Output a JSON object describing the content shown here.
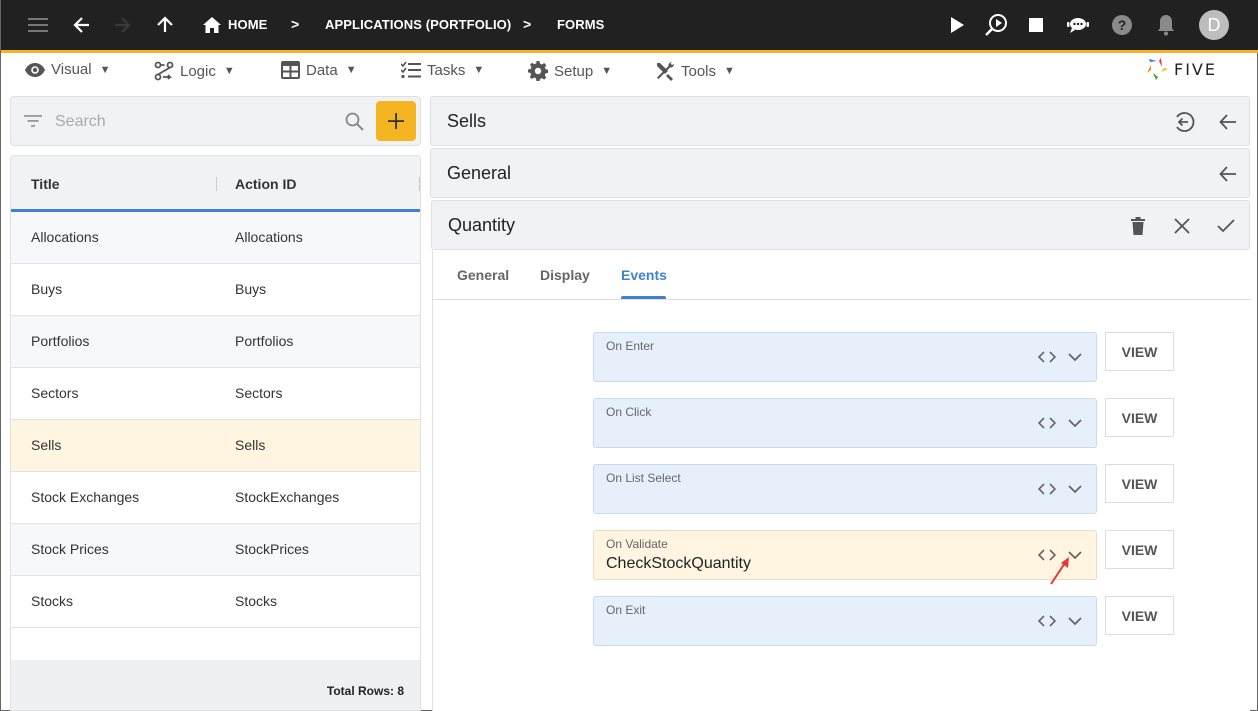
{
  "topbar": {
    "breadcrumbs": [
      "HOME",
      "APPLICATIONS (PORTFOLIO)",
      "FORMS"
    ],
    "avatar_initial": "D",
    "icons": [
      "menu-icon",
      "back-icon",
      "forward-icon",
      "up-icon",
      "home-icon",
      "play-icon",
      "inspect-play-icon",
      "stop-icon",
      "chat-bot-icon",
      "help-icon",
      "bell-icon"
    ]
  },
  "menubar": {
    "items": [
      {
        "label": "Visual",
        "icon": "eye-icon"
      },
      {
        "label": "Logic",
        "icon": "logic-icon"
      },
      {
        "label": "Data",
        "icon": "grid-icon"
      },
      {
        "label": "Tasks",
        "icon": "checklist-icon"
      },
      {
        "label": "Setup",
        "icon": "gear-icon"
      },
      {
        "label": "Tools",
        "icon": "tools-icon"
      }
    ],
    "caret": "▼",
    "logo_text": "FIVE"
  },
  "search": {
    "placeholder": "Search",
    "value": ""
  },
  "list": {
    "columns": [
      "Title",
      "Action ID"
    ],
    "rows": [
      {
        "title": "Allocations",
        "action_id": "Allocations"
      },
      {
        "title": "Buys",
        "action_id": "Buys"
      },
      {
        "title": "Portfolios",
        "action_id": "Portfolios"
      },
      {
        "title": "Sectors",
        "action_id": "Sectors"
      },
      {
        "title": "Sells",
        "action_id": "Sells",
        "selected": true
      },
      {
        "title": "Stock Exchanges",
        "action_id": "StockExchanges"
      },
      {
        "title": "Stock Prices",
        "action_id": "StockPrices"
      },
      {
        "title": "Stocks",
        "action_id": "Stocks"
      }
    ],
    "total_rows": "Total Rows: 8"
  },
  "panels": {
    "sells_title": "Sells",
    "general_title": "General",
    "quantity_title": "Quantity"
  },
  "form": {
    "tabs": [
      {
        "label": "General",
        "active": false
      },
      {
        "label": "Display",
        "active": false
      },
      {
        "label": "Events",
        "active": true
      }
    ],
    "events": [
      {
        "label": "On Enter",
        "value": ""
      },
      {
        "label": "On Click",
        "value": ""
      },
      {
        "label": "On List Select",
        "value": ""
      },
      {
        "label": "On Validate",
        "value": "CheckStockQuantity"
      },
      {
        "label": "On Exit",
        "value": ""
      }
    ],
    "view_label": "VIEW"
  },
  "colors": {
    "accent": "#f5b522",
    "primary_blue": "#3f82d4",
    "topbar_bg": "#212121",
    "selected_row": "#fff5e1",
    "event_field_bg": "#e6f0fb"
  }
}
